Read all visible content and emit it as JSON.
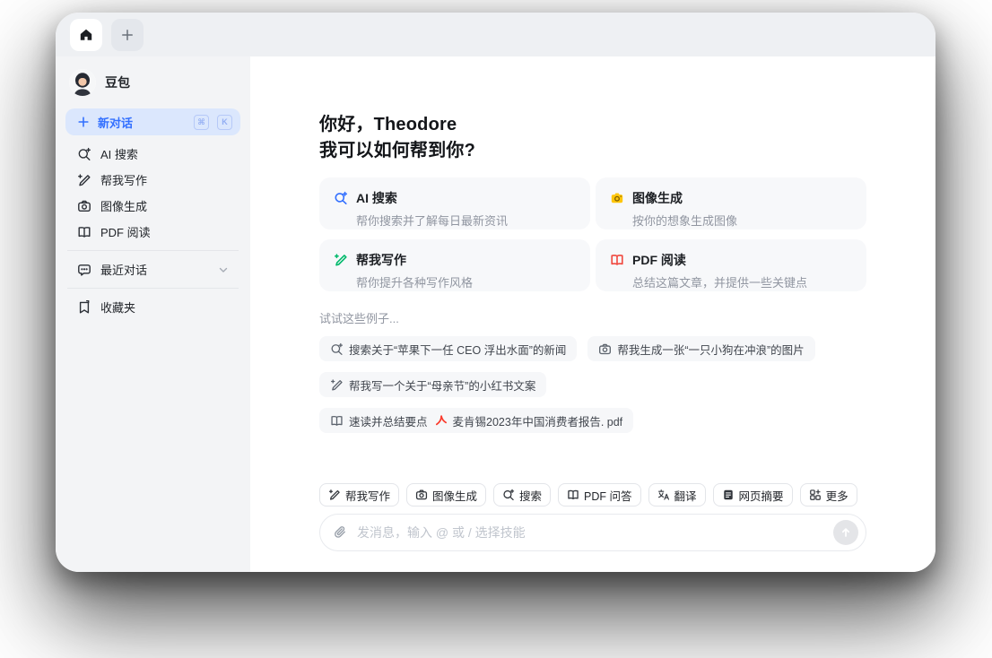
{
  "app": {
    "name": "豆包"
  },
  "colors": {
    "accent_blue": "#3370FF",
    "green": "#00B96B",
    "yellow": "#FFC60A",
    "red": "#F0483E",
    "sidebar_bg": "#F3F4F6",
    "tabbar_bg": "#EEF0F3",
    "card_bg": "#F7F8FA",
    "new_chat_bg": "#DBE7FD"
  },
  "tabbar": {
    "home_tab_icon": "home-icon",
    "new_tab_icon": "plus-icon"
  },
  "sidebar": {
    "profile": {
      "name": "豆包",
      "avatar_icon": "avatar"
    },
    "new_chat": {
      "label": "新对话",
      "icon": "plus-icon",
      "shortcut_keys": [
        "⌘",
        "K"
      ]
    },
    "items": [
      {
        "label": "AI 搜索",
        "icon": "search-sparkle-icon"
      },
      {
        "label": "帮我写作",
        "icon": "pen-plus-icon"
      },
      {
        "label": "图像生成",
        "icon": "camera-icon"
      },
      {
        "label": "PDF 阅读",
        "icon": "open-book-icon"
      }
    ],
    "recent": {
      "label": "最近对话",
      "icon": "chat-bubble-icon",
      "chevron_icon": "chevron-down-icon"
    },
    "favorites": {
      "label": "收藏夹",
      "icon": "bookmark-icon"
    }
  },
  "main": {
    "greeting": {
      "line1": "你好，Theodore",
      "line2": "我可以如何帮到你?"
    },
    "feature_cards": [
      {
        "title": "AI 搜索",
        "desc": "帮你搜索并了解每日最新资讯",
        "icon": "search-sparkle-icon",
        "color": "#3370FF"
      },
      {
        "title": "图像生成",
        "desc": "按你的想象生成图像",
        "icon": "camera-icon",
        "color": "#FFC60A"
      },
      {
        "title": "帮我写作",
        "desc": "帮你提升各种写作风格",
        "icon": "pen-plus-icon",
        "color": "#00B96B"
      },
      {
        "title": "PDF 阅读",
        "desc": "总结这篇文章，并提供一些关键点",
        "icon": "open-book-icon",
        "color": "#F0483E"
      }
    ],
    "examples": {
      "title": "试试这些例子...",
      "chips": [
        {
          "label": "搜索关于“苹果下一任 CEO 浮出水面”的新闻",
          "icon": "search-sparkle-icon"
        },
        {
          "label": "帮我生成一张“一只小狗在冲浪”的图片",
          "icon": "camera-icon"
        },
        {
          "label": "帮我写一个关于“母亲节”的小红书文案",
          "icon": "pen-plus-icon"
        },
        {
          "label": "速读并总结要点",
          "icon": "open-book-icon",
          "attachment": "麦肯锡2023年中国消费者报告. pdf",
          "attachment_icon": "pdf-file-icon"
        }
      ]
    },
    "skill_chips": [
      {
        "label": "帮我写作",
        "icon": "pen-plus-icon"
      },
      {
        "label": "图像生成",
        "icon": "camera-icon"
      },
      {
        "label": "搜索",
        "icon": "search-sparkle-icon"
      },
      {
        "label": "PDF 问答",
        "icon": "open-book-icon"
      },
      {
        "label": "翻译",
        "icon": "translate-icon"
      },
      {
        "label": "网页摘要",
        "icon": "webpage-icon"
      },
      {
        "label": "更多",
        "icon": "grid-plus-icon"
      }
    ],
    "composer": {
      "placeholder": "发消息，输入 @ 或 / 选择技能",
      "attach_icon": "paperclip-icon",
      "send_icon": "arrow-up-icon"
    }
  }
}
